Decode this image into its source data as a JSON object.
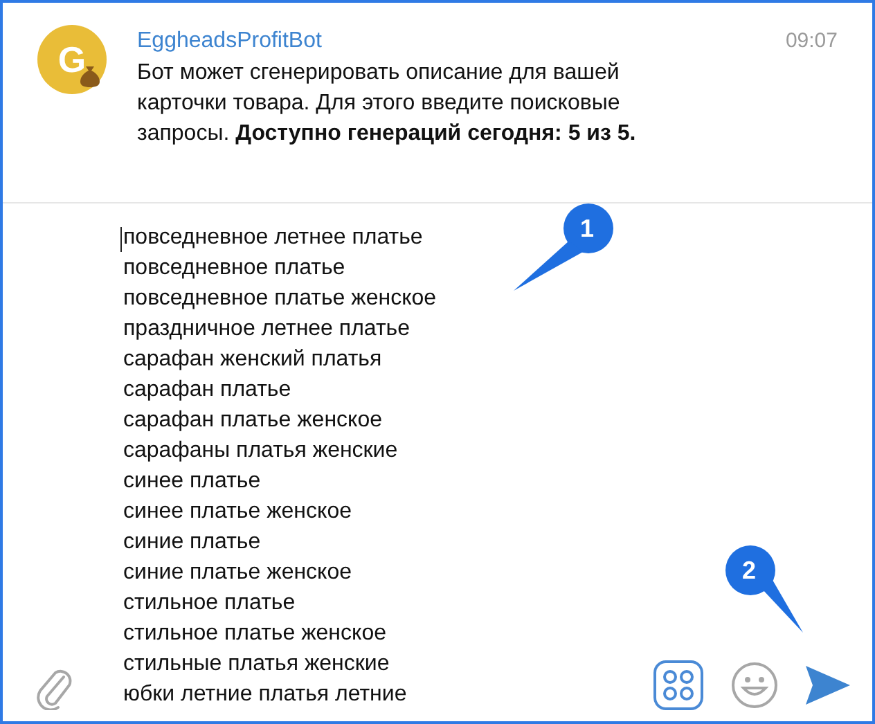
{
  "message": {
    "sender": "EggheadsProfitBot",
    "time": "09:07",
    "avatar_letter": "G",
    "text": "Бот может сгенерировать описание для вашей карточки товара. Для этого введите поисковые запросы. **Доступно генераций сегодня: 5 из 5.**"
  },
  "input": {
    "lines": [
      "повседневное летнее платье",
      "повседневное платье",
      "повседневное платье женское",
      "праздничное летнее платье",
      "сарафан женский платья",
      "сарафан платье",
      "сарафан платье женское",
      "сарафаны платья женские",
      "синее платье",
      "синее платье женское",
      "синие платье",
      "синие платье женское",
      "стильное платье",
      "стильное платье женское",
      "стильные платья женские",
      "юбки летние платья летние"
    ]
  },
  "callouts": [
    "1",
    "2"
  ]
}
